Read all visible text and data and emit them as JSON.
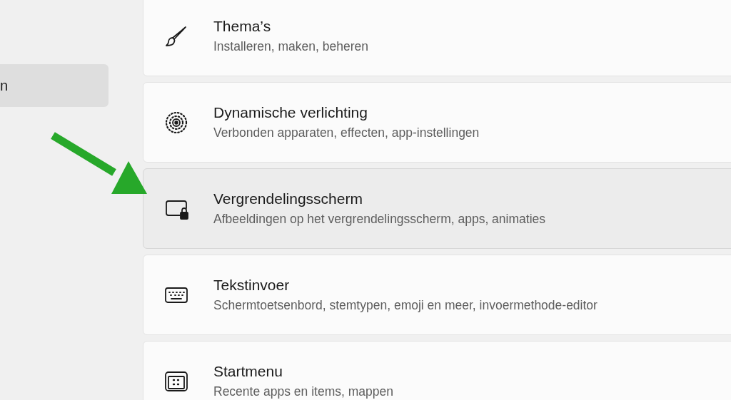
{
  "sidebar": {
    "items": [
      {
        "label": "n",
        "selected": true
      }
    ]
  },
  "cards": [
    {
      "title": "Thema’s",
      "subtitle": "Installeren, maken, beheren",
      "highlighted": false
    },
    {
      "title": "Dynamische verlichting",
      "subtitle": "Verbonden apparaten, effecten, app-instellingen",
      "highlighted": false
    },
    {
      "title": "Vergrendelingsscherm",
      "subtitle": "Afbeeldingen op het vergrendelingsscherm, apps, animaties",
      "highlighted": true
    },
    {
      "title": "Tekstinvoer",
      "subtitle": "Schermtoetsenbord, stemtypen, emoji en meer, invoermethode-editor",
      "highlighted": false
    },
    {
      "title": "Startmenu",
      "subtitle": "Recente apps en items, mappen",
      "highlighted": false
    }
  ]
}
